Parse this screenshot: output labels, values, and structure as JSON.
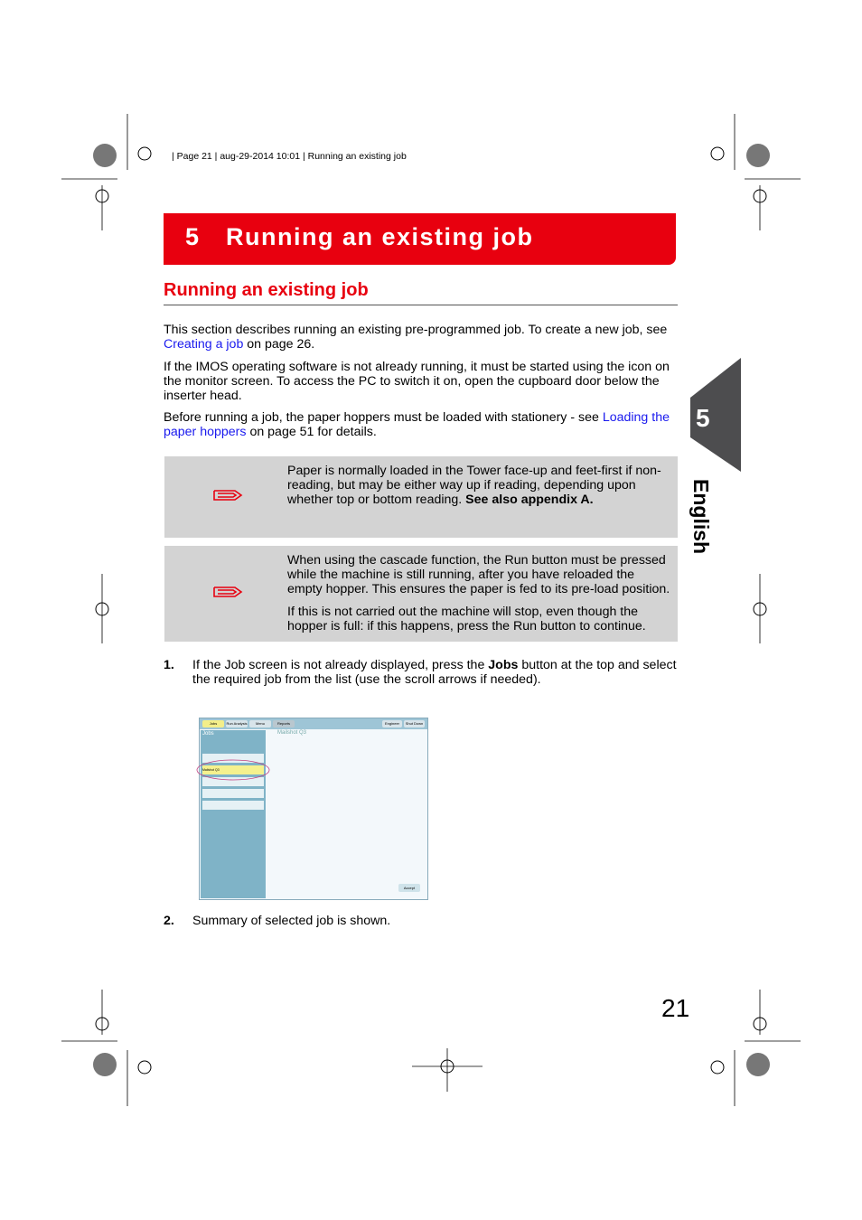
{
  "header": {
    "line": "|  Page 21 | aug-29-2014 10:01 | Running an existing job"
  },
  "chapter": {
    "number": "5",
    "title": "Running an existing job"
  },
  "section_title": "Running an existing job",
  "paragraphs": {
    "p1_a": "This section describes running an existing pre-programmed job. To create a new job, see ",
    "p1_link": "Creating a job",
    "p1_b": " on page 26.",
    "p2": "If the IMOS operating software is not already running, it must be started using the icon on the monitor screen. To access the PC to switch it on, open the cupboard door below the inserter head.",
    "p3_a": "Before running a job, the paper hoppers must be loaded with stationery - see ",
    "p3_link": "Loading the paper hoppers",
    "p3_b": " on page 51 for details."
  },
  "notes": [
    {
      "icon": "paperclip-icon",
      "text": "Paper is normally loaded in the Tower face-up and feet-first if non-reading, but may be either way up if reading, depending upon whether top or bottom reading. ",
      "bold": "See also appendix A."
    },
    {
      "icon": "paperclip-icon",
      "text1": "When using the cascade function, the Run button must be pressed while the machine is still running, after you have reloaded the empty hopper. This ensures the paper is fed to its pre-load position.",
      "text2": "If this is not carried out the machine will stop, even though the hopper is full: if this happens, press the Run button to continue."
    }
  ],
  "steps": [
    {
      "num": "1.",
      "a": "If the Job screen is not already displayed, press the ",
      "bold": "Jobs",
      "b": " button at the top and select the required job from the list (use the scroll arrows if needed)."
    },
    {
      "num": "2.",
      "a": "Summary of selected job is shown."
    }
  ],
  "screenshot": {
    "tabs": [
      "Jobs",
      "Run Analysis",
      "Menu",
      "Reports"
    ],
    "right_buttons": [
      "Engineer",
      "Shut Down"
    ],
    "panel_title": "Jobs",
    "job_title": "Mailshot Q3",
    "selected_job": "Mailshot Q3",
    "accept": "Accept"
  },
  "side_tab": {
    "number": "5",
    "language": "English"
  },
  "page_number": "21",
  "colors": {
    "accent": "#e8000f",
    "link": "#1a1aee",
    "note_bg": "#d3d3d3",
    "tab": "#4d4d4f"
  }
}
